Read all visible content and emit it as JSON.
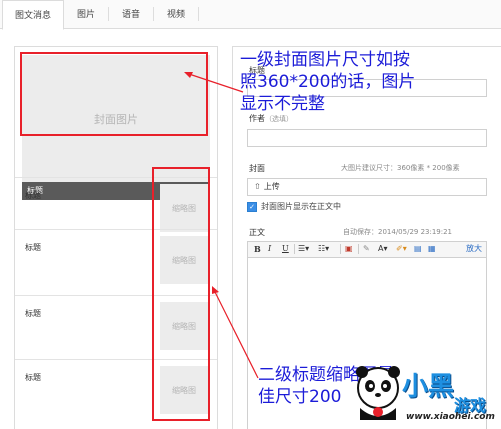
{
  "tabs": [
    {
      "label": "图文消息",
      "active": true
    },
    {
      "label": "图片",
      "active": false
    },
    {
      "label": "语音",
      "active": false
    },
    {
      "label": "视频",
      "active": false
    }
  ],
  "left": {
    "cover_placeholder": "封面图片",
    "cover_title": "标题",
    "items": [
      {
        "title": "标题",
        "thumb": "缩略图"
      },
      {
        "title": "标题",
        "thumb": "缩略图"
      },
      {
        "title": "标题",
        "thumb": "缩略图"
      },
      {
        "title": "标题",
        "thumb": "缩略图"
      }
    ]
  },
  "form": {
    "title_label": "标题",
    "author_label": "作者",
    "author_hint": "（选填）",
    "cover_label": "封面",
    "cover_size_hint": "大图片建议尺寸：360像素 * 200像素",
    "upload_label": "上传",
    "show_cover_label": "封面图片显示在正文中",
    "body_label": "正文",
    "autosave": "自动保存：2014/05/29 23:19:21",
    "toolbar": {
      "bold": "B",
      "italic": "I",
      "underline": "U",
      "font_size": "A",
      "enlarge": "放大"
    }
  },
  "annotations": {
    "top_line1": "一级封面图片尺寸如按",
    "top_line2": "照360*200的话，图片",
    "top_line3": "显示不完整",
    "bottom_line1": "二级标题缩略图最",
    "bottom_line2": "佳尺寸200"
  },
  "watermark": {
    "brand": "小黑",
    "brand2": "游戏",
    "url": "www.xiaohei.com"
  },
  "colors": {
    "annotation_text": "#1c1cd8",
    "annotation_box": "#e8202a",
    "cover_bar": "#5a5a5a",
    "placeholder_bg": "#ececec",
    "link": "#2b6cc4"
  }
}
